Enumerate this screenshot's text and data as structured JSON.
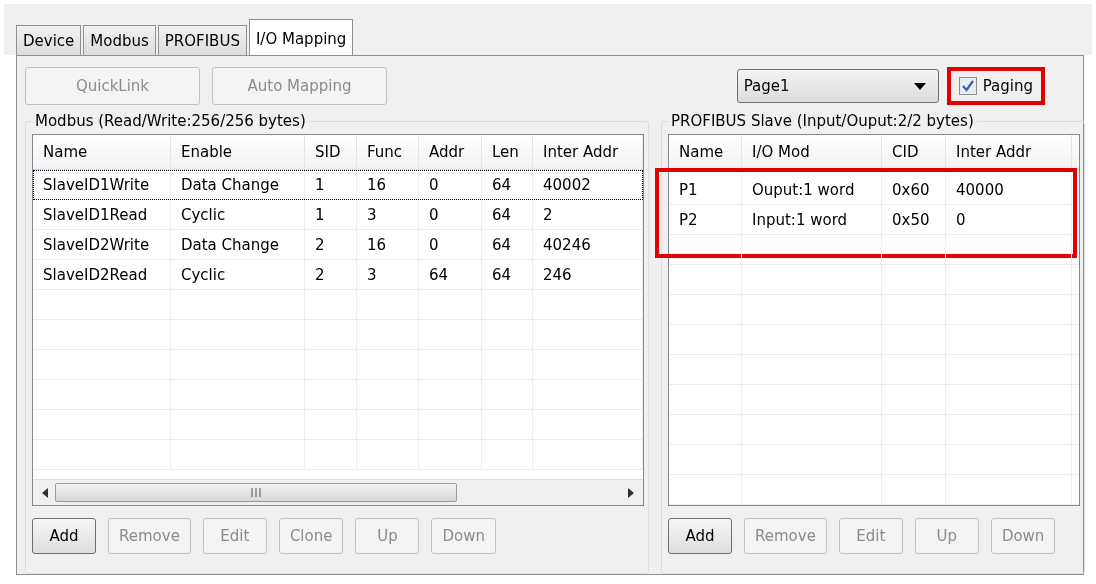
{
  "tabs": [
    {
      "label": "Device",
      "selected": false
    },
    {
      "label": "Modbus",
      "selected": false
    },
    {
      "label": "PROFIBUS",
      "selected": false
    },
    {
      "label": "I/O Mapping",
      "selected": true
    }
  ],
  "toolbar": {
    "buttons": [
      {
        "label": "QuickLink",
        "disabled": true
      },
      {
        "label": "Auto Mapping",
        "disabled": true
      }
    ],
    "page_select": {
      "value": "Page1"
    },
    "paging": {
      "label": "Paging",
      "checked": true,
      "highlighted": true
    }
  },
  "modbus": {
    "title": "Modbus (Read/Write:256/256 bytes)",
    "columns": [
      "Name",
      "Enable",
      "SID",
      "Func",
      "Addr",
      "Len",
      "Inter Addr"
    ],
    "rows": [
      [
        "SlaveID1Write",
        "Data Change",
        "1",
        "16",
        "0",
        "64",
        "40002"
      ],
      [
        "SlaveID1Read",
        "Cyclic",
        "1",
        "3",
        "0",
        "64",
        "2"
      ],
      [
        "SlaveID2Write",
        "Data Change",
        "2",
        "16",
        "0",
        "64",
        "40246"
      ],
      [
        "SlaveID2Read",
        "Cyclic",
        "2",
        "3",
        "64",
        "64",
        "246"
      ]
    ],
    "buttons": [
      {
        "label": "Add",
        "disabled": false
      },
      {
        "label": "Remove",
        "disabled": true
      },
      {
        "label": "Edit",
        "disabled": true
      },
      {
        "label": "Clone",
        "disabled": true
      },
      {
        "label": "Up",
        "disabled": true
      },
      {
        "label": "Down",
        "disabled": true
      }
    ]
  },
  "profibus": {
    "title": "PROFIBUS Slave (Input/Ouput:2/2 bytes)",
    "columns": [
      "Name",
      "I/O Mod",
      "CID",
      "Inter Addr"
    ],
    "rows_highlighted": true,
    "rows": [
      [
        "P1",
        "Ouput:1 word",
        "0x60",
        "40000"
      ],
      [
        "P2",
        "Input:1 word",
        "0x50",
        "0"
      ]
    ],
    "buttons": [
      {
        "label": "Add",
        "disabled": false
      },
      {
        "label": "Remove",
        "disabled": true
      },
      {
        "label": "Edit",
        "disabled": true
      },
      {
        "label": "Up",
        "disabled": true
      },
      {
        "label": "Down",
        "disabled": true
      }
    ]
  }
}
